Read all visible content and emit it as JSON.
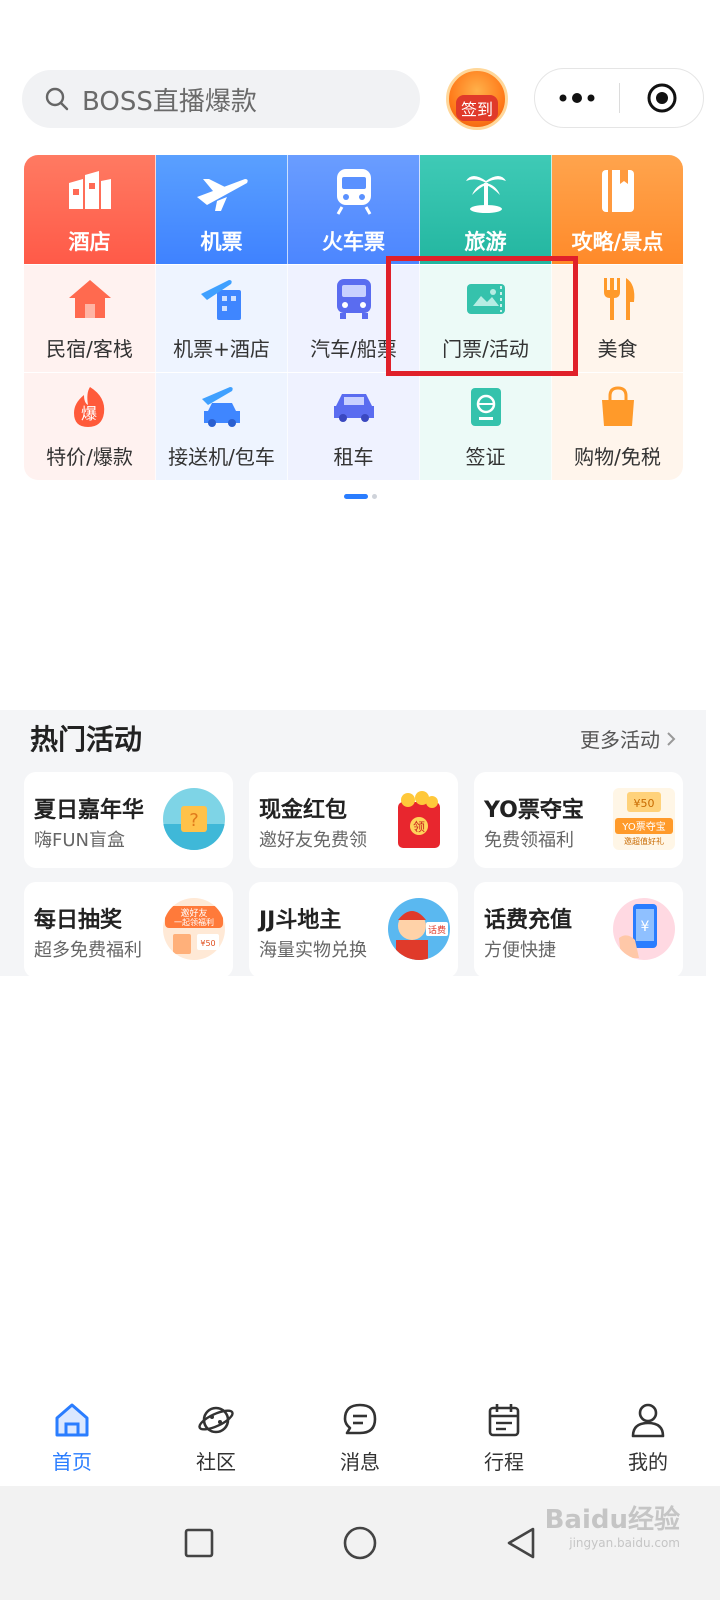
{
  "search": {
    "placeholder": "BOSS直播爆款"
  },
  "checkin": {
    "label": "签到"
  },
  "services_main": [
    {
      "label": "酒店",
      "icon": "hotel-icon"
    },
    {
      "label": "机票",
      "icon": "plane-icon"
    },
    {
      "label": "火车票",
      "icon": "train-icon"
    },
    {
      "label": "旅游",
      "icon": "palm-tree-icon"
    },
    {
      "label": "攻略/景点",
      "icon": "guidebook-icon"
    }
  ],
  "services_row2": [
    {
      "label": "民宿/客栈",
      "icon": "house-icon"
    },
    {
      "label": "机票+酒店",
      "icon": "plane-hotel-icon"
    },
    {
      "label": "汽车/船票",
      "icon": "bus-icon"
    },
    {
      "label": "门票/活动",
      "icon": "ticket-icon"
    },
    {
      "label": "美食",
      "icon": "fork-knife-icon"
    }
  ],
  "services_row3": [
    {
      "label": "特价/爆款",
      "icon": "flame-deal-icon"
    },
    {
      "label": "接送机/包车",
      "icon": "plane-car-icon"
    },
    {
      "label": "租车",
      "icon": "car-icon"
    },
    {
      "label": "签证",
      "icon": "passport-icon"
    },
    {
      "label": "购物/免税",
      "icon": "shopping-bag-icon"
    }
  ],
  "pager": {
    "active_index": 0,
    "count": 2
  },
  "hot": {
    "title": "热门活动",
    "more_label": "更多活动",
    "cards": [
      {
        "title": "夏日嘉年华",
        "subtitle": "嗨FUN盲盒"
      },
      {
        "title": "现金红包",
        "subtitle": "邀好友免费领"
      },
      {
        "title": "YO票夺宝",
        "subtitle": "免费领福利"
      },
      {
        "title": "每日抽奖",
        "subtitle": "超多免费福利"
      },
      {
        "title": "JJ斗地主",
        "subtitle": "海量实物兑换"
      },
      {
        "title": "话费充值",
        "subtitle": "方便快捷"
      }
    ],
    "card_badges": {
      "redpacket": "领",
      "yopiao": "¥50",
      "yopiao_banner": "YO票夺宝",
      "yopiao_sub": "邀超值好礼",
      "lottery_banner": "邀好友",
      "lottery_sub": "一起领福利",
      "lottery_amount": "¥50",
      "jj_tag": "话费",
      "phone_symbol": "¥"
    }
  },
  "tabbar": [
    {
      "label": "首页",
      "icon": "home-icon",
      "active": true
    },
    {
      "label": "社区",
      "icon": "planet-icon",
      "active": false
    },
    {
      "label": "消息",
      "icon": "chat-icon",
      "active": false
    },
    {
      "label": "行程",
      "icon": "calendar-icon",
      "active": false
    },
    {
      "label": "我的",
      "icon": "user-icon",
      "active": false
    }
  ],
  "colors": {
    "accent": "#2a7dff",
    "highlight_box": "#e0202a"
  },
  "watermark": {
    "brand": "Baidu经验",
    "url": "jingyan.baidu.com"
  }
}
